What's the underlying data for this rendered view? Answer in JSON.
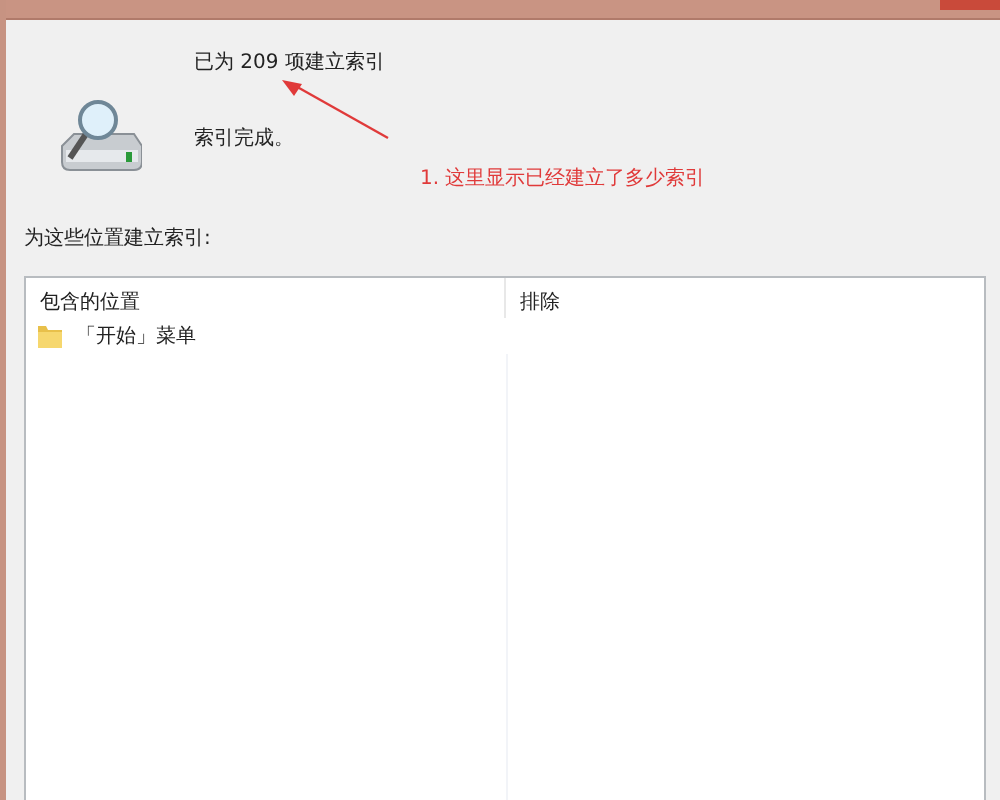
{
  "status": {
    "count_text": "已为 209 项建立索引",
    "message": "索引完成。"
  },
  "annotation": {
    "text": "1. 这里显示已经建立了多少索引"
  },
  "locations_label": "为这些位置建立索引:",
  "table": {
    "columns": [
      "包含的位置",
      "排除"
    ],
    "rows": [
      {
        "location": "「开始」菜单",
        "excluded": ""
      }
    ]
  }
}
